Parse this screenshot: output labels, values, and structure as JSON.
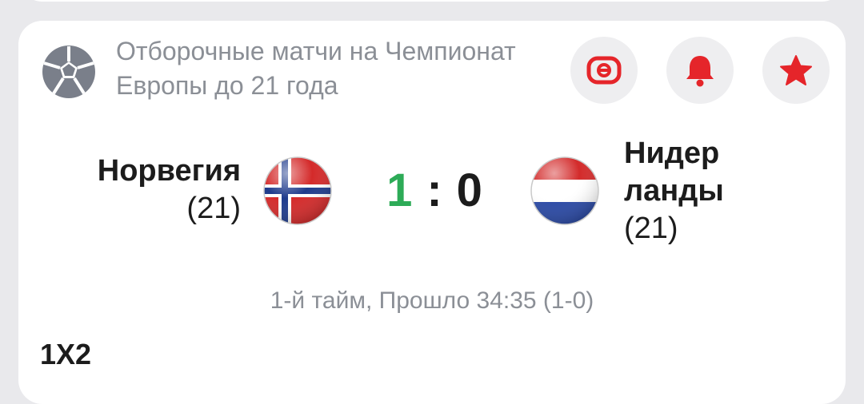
{
  "league": {
    "icon": "soccer-ball-icon",
    "title": "Отборочные матчи на Чемпионат Европы до 21 года"
  },
  "actions": [
    {
      "icon": "stream-icon",
      "color": "#e5252a"
    },
    {
      "icon": "bell-icon",
      "color": "#e5252a"
    },
    {
      "icon": "star-icon",
      "color": "#e5252a"
    }
  ],
  "match": {
    "home": {
      "name": "Норвегия",
      "suffix": "(21)",
      "flag": "norway-flag-icon"
    },
    "away": {
      "name_line1": "Нидер",
      "name_line2": "ланды",
      "suffix": "(21)",
      "flag": "netherlands-flag-icon"
    },
    "score": {
      "home": "1",
      "separator": ":",
      "away": "0"
    },
    "status": "1-й тайм, Прошло 34:35 (1-0)"
  },
  "market": {
    "title": "1X2"
  },
  "colors": {
    "score_leading": "#2dab57",
    "accent": "#e5252a",
    "muted": "#8b8f96"
  }
}
